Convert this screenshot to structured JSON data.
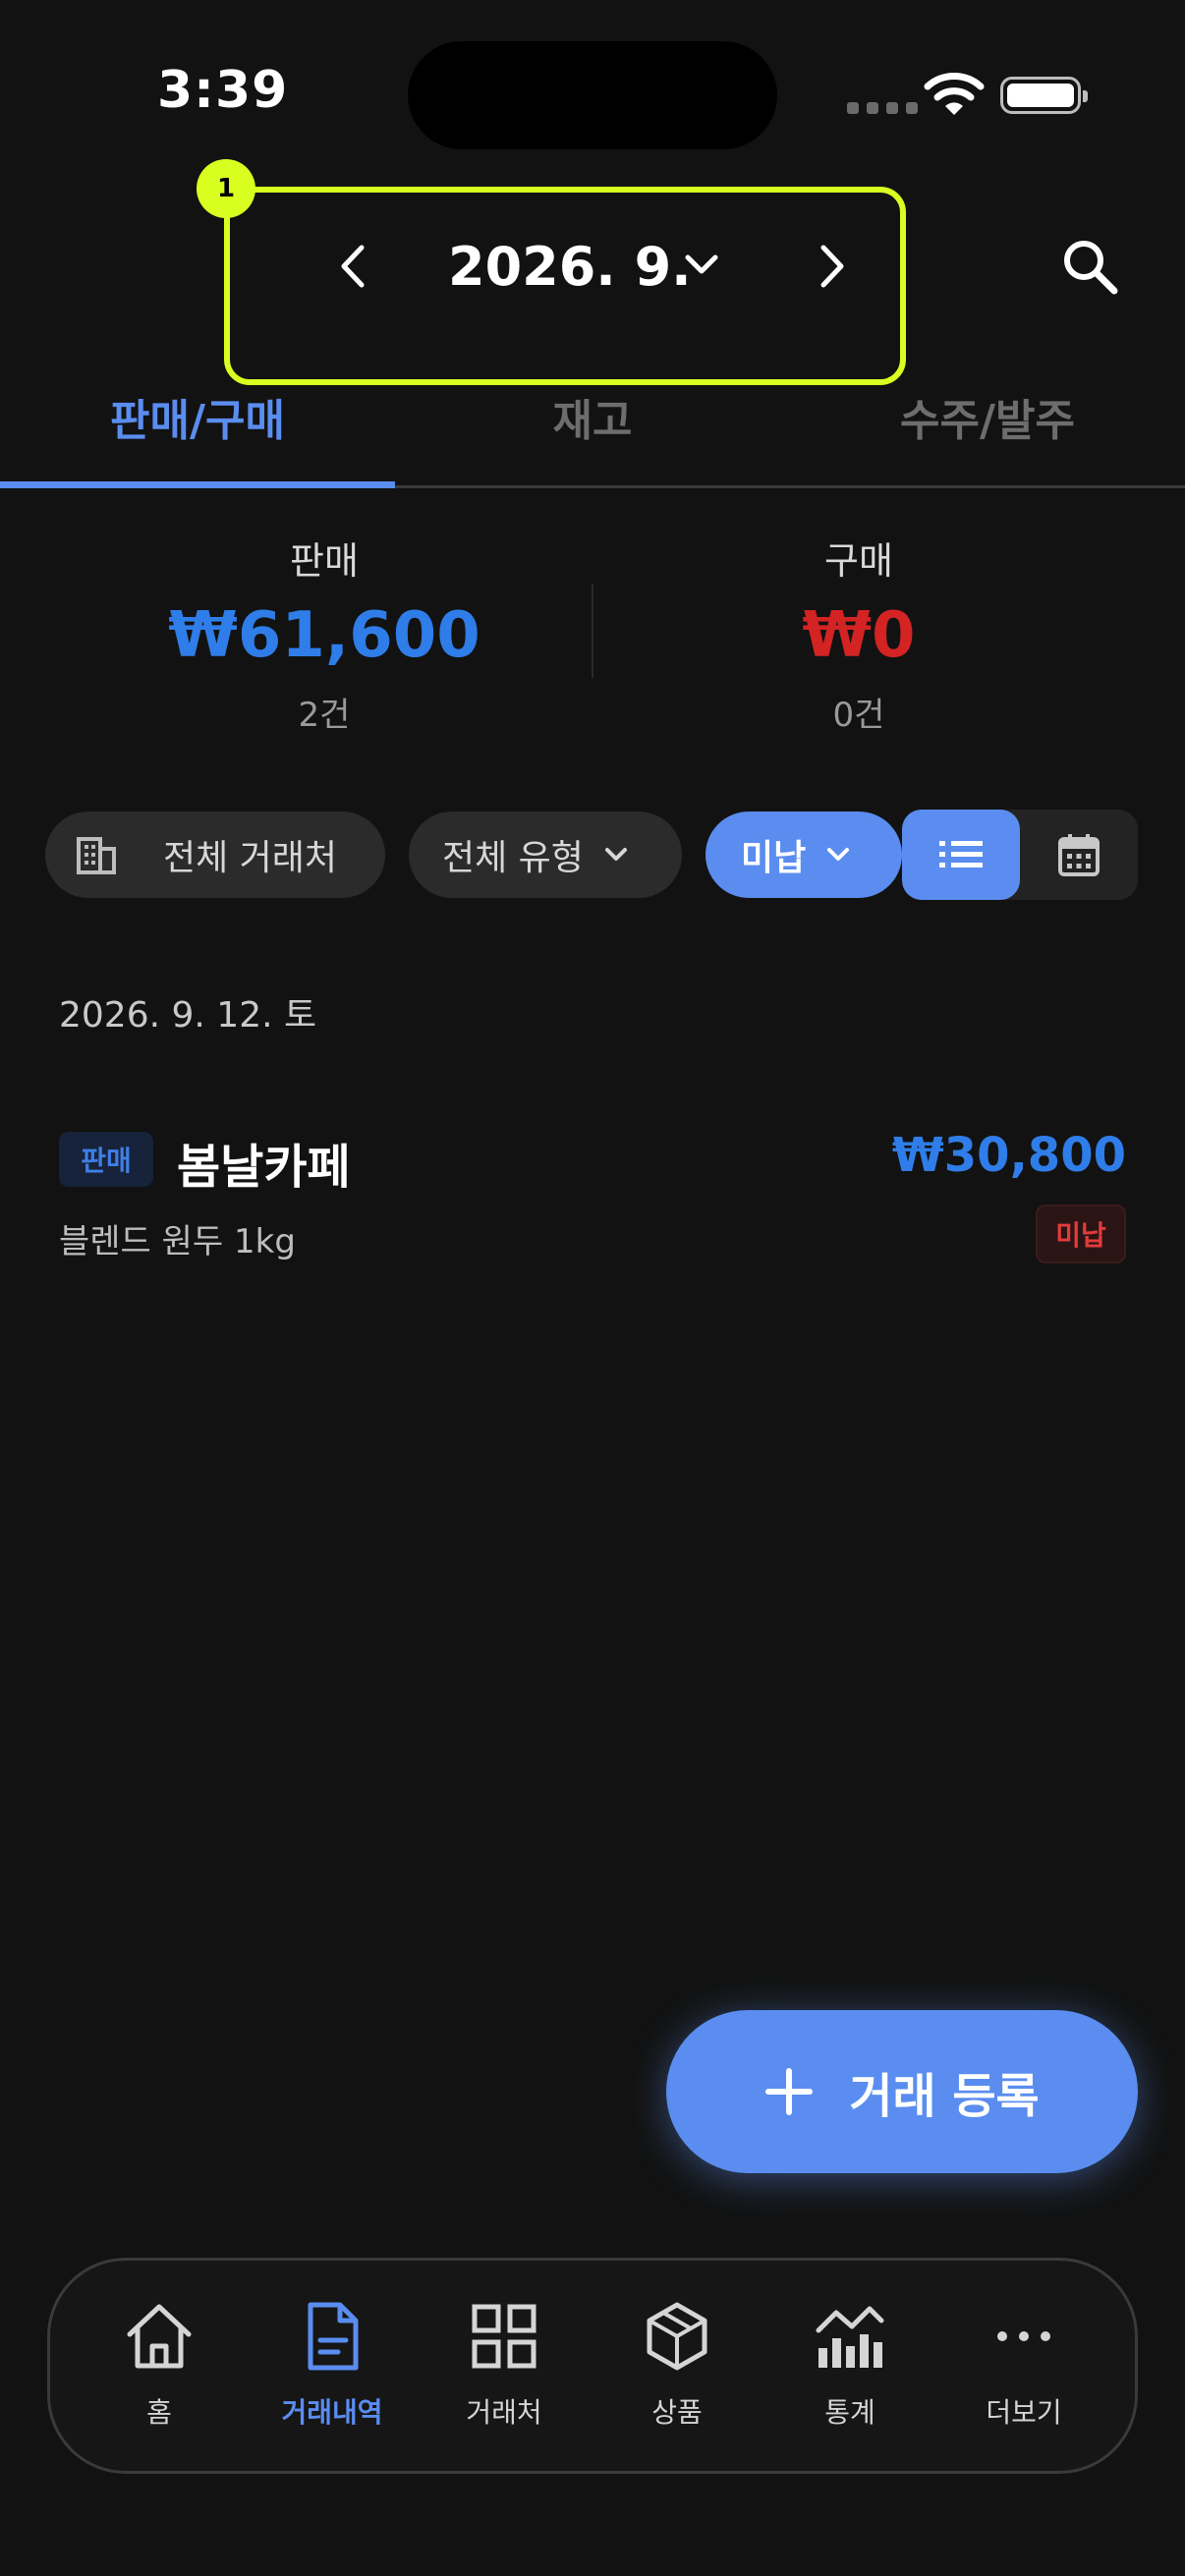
{
  "status_bar": {
    "time": "3:39"
  },
  "header": {
    "month_label": "2026. 9.",
    "badge_number": "1"
  },
  "tabs": [
    {
      "label": "판매/구매",
      "active": true
    },
    {
      "label": "재고",
      "active": false
    },
    {
      "label": "수주/발주",
      "active": false
    }
  ],
  "summary": {
    "sales": {
      "label": "판매",
      "amount": "₩61,600",
      "count": "2건",
      "color": "#2f7de8"
    },
    "purchase": {
      "label": "구매",
      "amount": "₩0",
      "count": "0건",
      "color": "#d32323"
    }
  },
  "filters": {
    "partner": "전체 거래처",
    "type": "전체 유형",
    "payment": "미납"
  },
  "list": {
    "date_header": "2026. 9. 12. 토",
    "transactions": [
      {
        "tag": "판매",
        "partner": "봄날카페",
        "amount": "₩30,800",
        "item": "블렌드 원두 1kg",
        "status": "미납"
      }
    ]
  },
  "fab": {
    "label": "거래 등록"
  },
  "bottom_nav": [
    {
      "label": "홈",
      "icon": "home-icon"
    },
    {
      "label": "거래내역",
      "icon": "document-icon",
      "active": true
    },
    {
      "label": "거래처",
      "icon": "grid-icon"
    },
    {
      "label": "상품",
      "icon": "box-icon"
    },
    {
      "label": "통계",
      "icon": "chart-icon"
    },
    {
      "label": "더보기",
      "icon": "more-icon"
    }
  ],
  "colors": {
    "accent": "#5a8def",
    "highlight": "#d8ff1f",
    "background": "#121212"
  }
}
